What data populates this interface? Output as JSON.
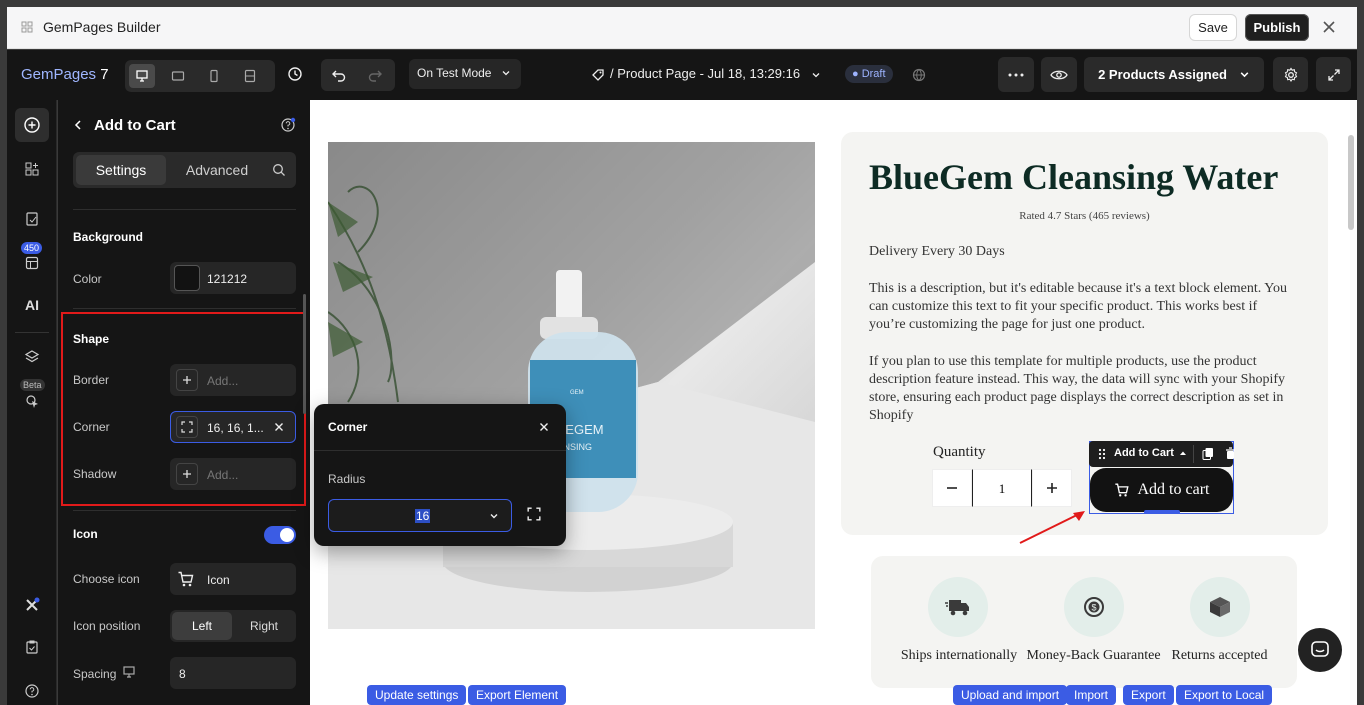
{
  "window": {
    "title": "GemPages Builder",
    "save_label": "Save",
    "publish_label": "Publish"
  },
  "toolbar": {
    "logo_text": "GemPages",
    "logo_version": "7",
    "mode": "On Test Mode",
    "page_title": "/ Product Page - Jul 18, 13:29:16",
    "status": "Draft",
    "assigned": "2 Products Assigned"
  },
  "rail": {
    "badge_count": "450",
    "ai_label": "AI",
    "beta_label": "Beta"
  },
  "panel": {
    "title": "Add to Cart",
    "tabs": [
      "Settings",
      "Advanced"
    ],
    "background": {
      "section": "Background",
      "color_label": "Color",
      "color_value": "121212"
    },
    "shape": {
      "section": "Shape",
      "border_label": "Border",
      "border_placeholder": "Add...",
      "corner_label": "Corner",
      "corner_value": "16, 16, 1...",
      "shadow_label": "Shadow",
      "shadow_placeholder": "Add..."
    },
    "icon": {
      "section": "Icon",
      "toggle_on": true,
      "choose_label": "Choose icon",
      "choose_value": "Icon",
      "position_label": "Icon position",
      "position_options": [
        "Left",
        "Right"
      ],
      "position_selected": "Left",
      "spacing_label": "Spacing",
      "spacing_value": "8"
    }
  },
  "popover": {
    "title": "Corner",
    "radius_label": "Radius",
    "radius_value": "16"
  },
  "product": {
    "title": "BlueGem Cleansing Water",
    "rating": "Rated 4.7 Stars (465 reviews)",
    "delivery": "Delivery Every 30 Days",
    "desc1_lines": [
      "This is a description, but it's editable because it's a text block element. You",
      "can customize this text to fit your specific product. This works best if",
      "you’re customizing the page for just one product."
    ],
    "desc2_lines": [
      "If you plan to use this template for multiple products, use the product",
      "description feature instead. This way, the data will sync with your Shopify",
      "store, ensuring each product page displays the correct description as set in",
      "Shopify"
    ],
    "quantity_label": "Quantity",
    "quantity_value": "1",
    "add_to_cart": "Add to cart",
    "selection_label": "Add to Cart",
    "bottle_label_1": "GEM",
    "bottle_label_2": "BLUEGEM",
    "bottle_label_3": "CLEANSING"
  },
  "features": [
    "Ships internationally",
    "Money-Back Guarantee",
    "Returns accepted"
  ],
  "bottom_buttons_left": [
    "Update settings",
    "Export Element"
  ],
  "bottom_buttons_right": [
    "Upload and import",
    "Import",
    "Export",
    "Export to Local"
  ],
  "colors": {
    "accent": "#3b5ce4",
    "button_bg": "#121212",
    "highlight_border": "#e11a1a",
    "title_text": "#0d2b24"
  }
}
